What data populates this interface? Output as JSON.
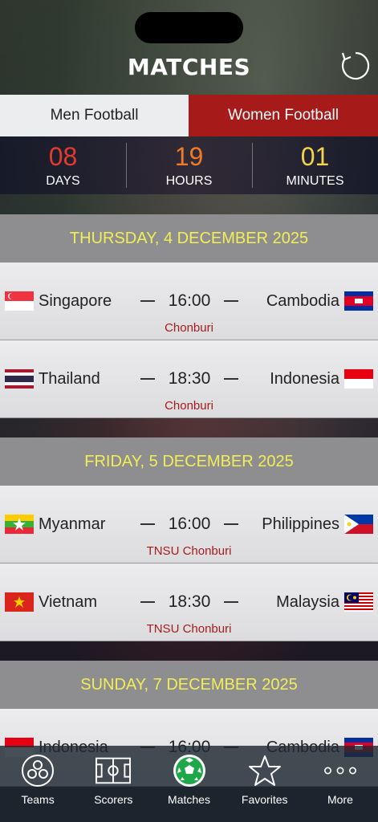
{
  "header": {
    "title": "MATCHES"
  },
  "tabs": [
    {
      "label": "Men Football",
      "active": false
    },
    {
      "label": "Women Football",
      "active": true
    }
  ],
  "countdown": {
    "days": {
      "value": "08",
      "label": "DAYS",
      "color": "#e53b2f"
    },
    "hours": {
      "value": "19",
      "label": "HOURS",
      "color": "#f07a2a"
    },
    "minutes": {
      "value": "01",
      "label": "MINUTES",
      "color": "#f4d44c"
    }
  },
  "days": [
    {
      "date": "THURSDAY, 4 DECEMBER 2025",
      "matches": [
        {
          "home": "Singapore",
          "home_flag": "singapore",
          "time": "16:00",
          "away": "Cambodia",
          "away_flag": "cambodia",
          "venue": "Chonburi"
        },
        {
          "home": "Thailand",
          "home_flag": "thailand",
          "time": "18:30",
          "away": "Indonesia",
          "away_flag": "indonesia",
          "venue": "Chonburi"
        }
      ]
    },
    {
      "date": "FRIDAY, 5 DECEMBER 2025",
      "matches": [
        {
          "home": "Myanmar",
          "home_flag": "myanmar",
          "time": "16:00",
          "away": "Philippines",
          "away_flag": "philippines",
          "venue": "TNSU Chonburi"
        },
        {
          "home": "Vietnam",
          "home_flag": "vietnam",
          "time": "18:30",
          "away": "Malaysia",
          "away_flag": "malaysia",
          "venue": "TNSU Chonburi"
        }
      ]
    },
    {
      "date": "SUNDAY, 7 DECEMBER 2025",
      "matches": [
        {
          "home": "Indonesia",
          "home_flag": "indonesia",
          "time": "16:00",
          "away": "Cambodia",
          "away_flag": "cambodia",
          "venue": ""
        }
      ]
    }
  ],
  "nav": [
    {
      "label": "Teams",
      "icon": "teams-icon"
    },
    {
      "label": "Scorers",
      "icon": "pitch-icon"
    },
    {
      "label": "Matches",
      "icon": "soccer-ball-icon"
    },
    {
      "label": "Favorites",
      "icon": "star-icon"
    },
    {
      "label": "More",
      "icon": "more-dots-icon"
    }
  ]
}
